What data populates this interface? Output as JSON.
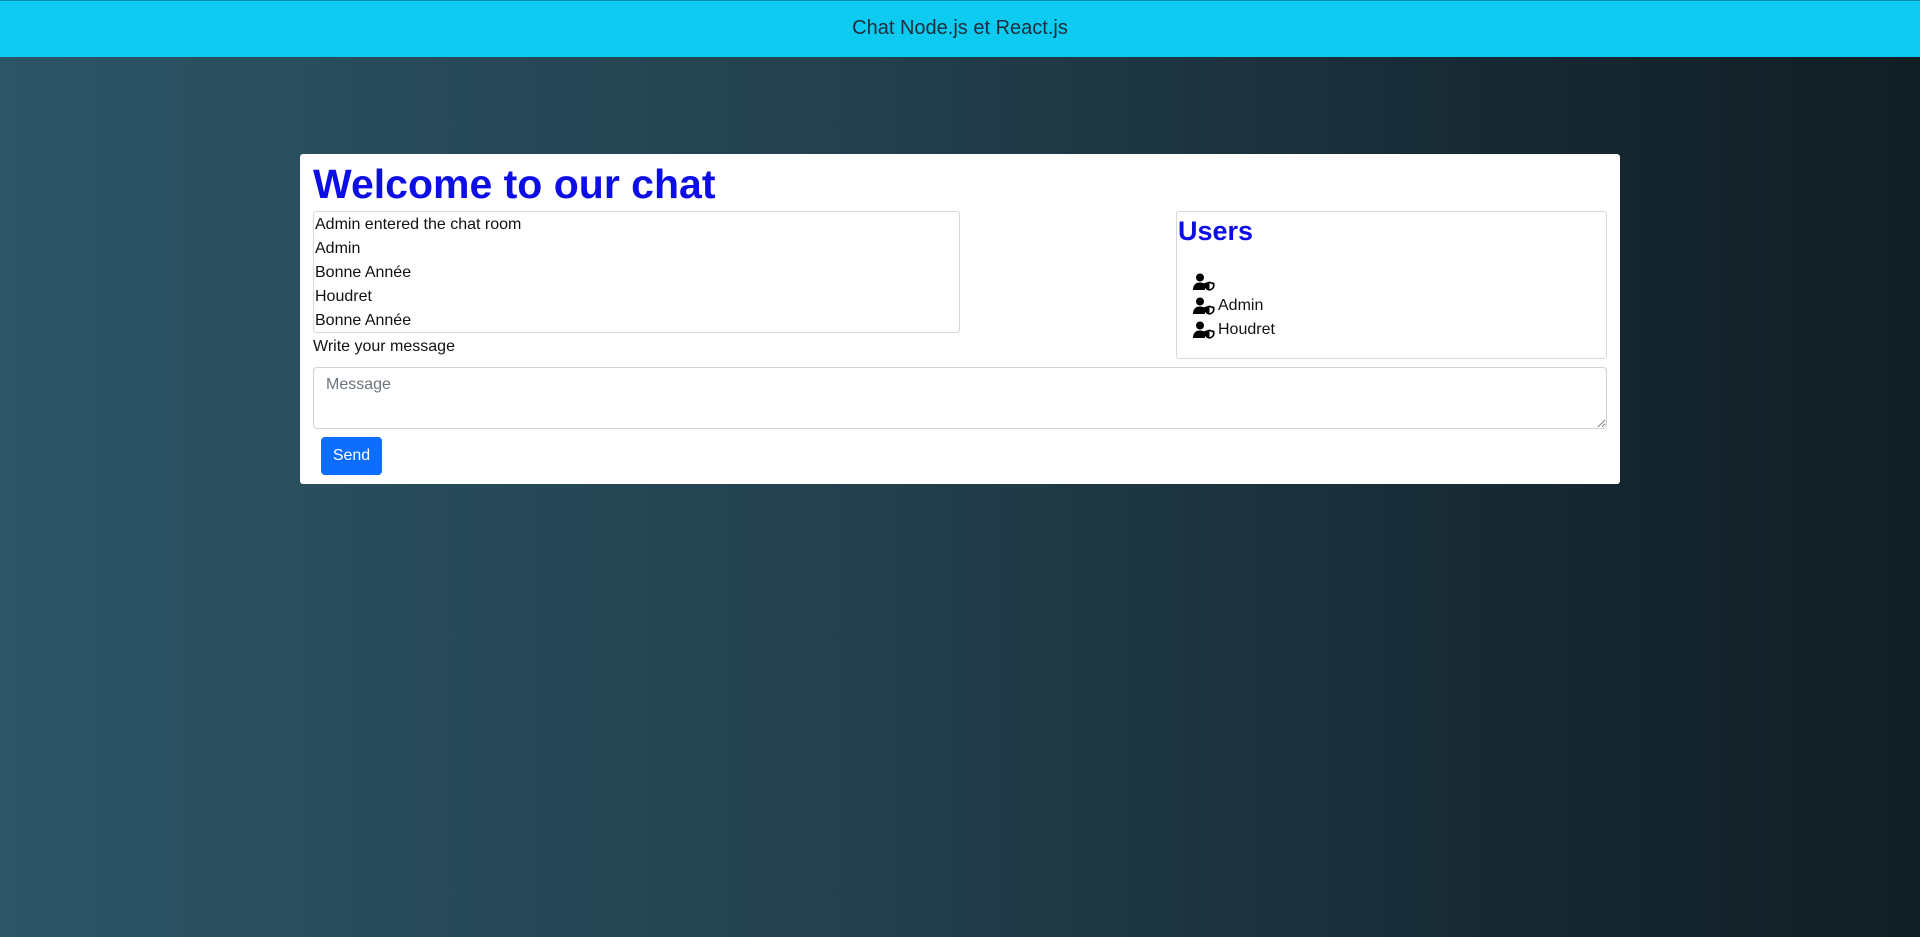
{
  "navbar": {
    "title": "Chat Node.js et React.js"
  },
  "chat": {
    "welcome_title": "Welcome to our chat",
    "messages": [
      "Admin entered the chat room",
      "Admin",
      "Bonne Année",
      "Houdret",
      "Bonne Année"
    ],
    "write_label": "Write your message",
    "input_placeholder": "Message",
    "input_value": "",
    "send_label": "Send"
  },
  "users": {
    "title": "Users",
    "icon": "user-shield-icon",
    "items": [
      {
        "name": ""
      },
      {
        "name": "Admin"
      },
      {
        "name": "Houdret"
      }
    ]
  },
  "colors": {
    "navbar_bg": "#0dcaf0",
    "heading": "#0d0de6",
    "send_button": "#0d6efd",
    "background_left": "#2c5566",
    "background_right": "#111e24"
  }
}
